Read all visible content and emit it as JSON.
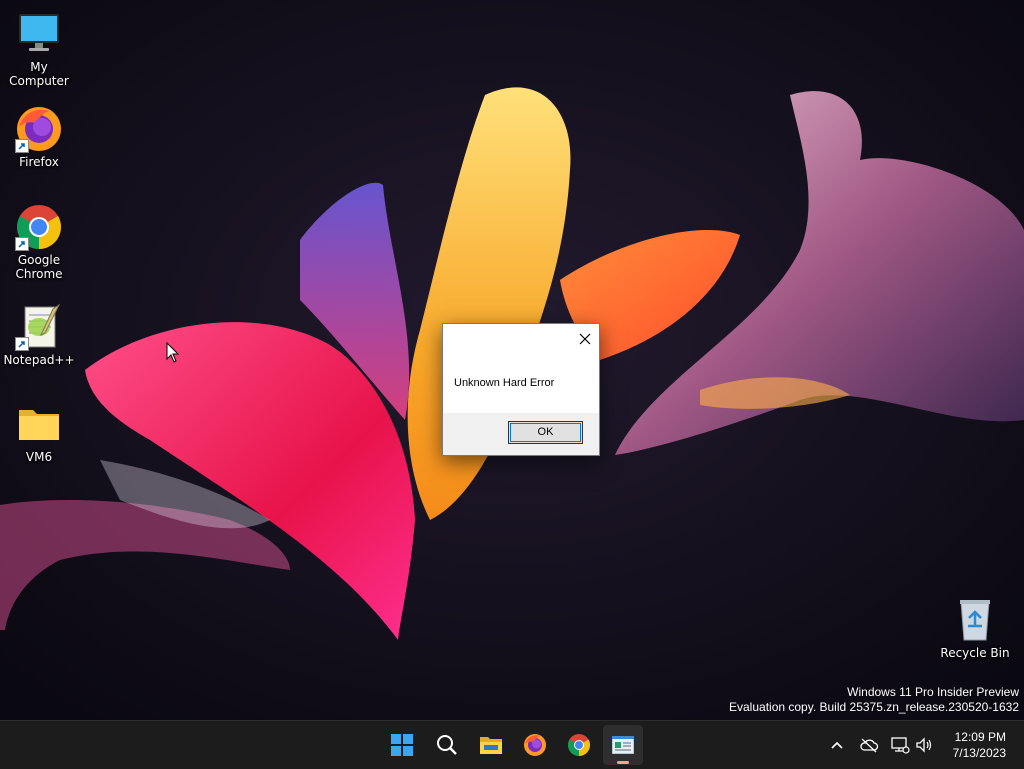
{
  "desktop": {
    "icons": [
      {
        "label": "My Computer",
        "icon": "monitor-icon"
      },
      {
        "label": "Firefox",
        "icon": "firefox-icon"
      },
      {
        "label": "Google Chrome",
        "icon": "chrome-icon"
      },
      {
        "label": "Notepad++",
        "icon": "notepadpp-icon"
      },
      {
        "label": "VM6",
        "icon": "folder-icon"
      },
      {
        "label": "Recycle Bin",
        "icon": "recycle-bin-icon"
      }
    ]
  },
  "dialog": {
    "message": "Unknown Hard Error",
    "ok_label": "OK"
  },
  "watermark": {
    "line1": "Windows 11 Pro Insider Preview",
    "line2": "Evaluation copy. Build 25375.zn_release.230520-1632"
  },
  "taskbar": {
    "apps": [
      "start-icon",
      "search-icon",
      "file-explorer-icon",
      "firefox-icon",
      "chrome-icon",
      "hard-error-app-icon"
    ],
    "active_app": "hard-error-app-icon",
    "tray": [
      "chevron-up-icon",
      "cloud-off-icon",
      "network-icon",
      "volume-icon"
    ],
    "time": "12:09 PM",
    "date": "7/13/2023"
  },
  "colors": {
    "background": "#0d0b14",
    "taskbar": "#1c1c1c",
    "accent": "#0078d4"
  }
}
